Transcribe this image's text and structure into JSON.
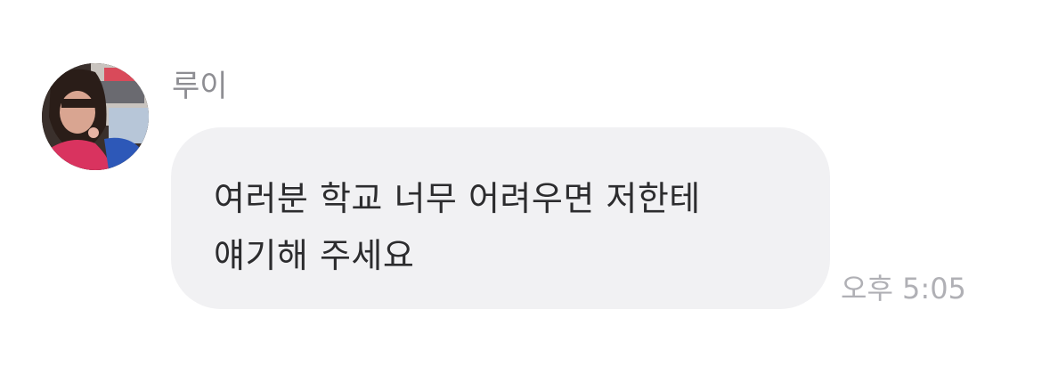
{
  "sender": {
    "name": "루이",
    "avatar_icon": "profile-photo"
  },
  "message": {
    "lines": [
      "여러분 학교 너무 어려우면 저한테",
      "얘기해 주세요"
    ]
  },
  "timestamp": "오후 5:05",
  "colors": {
    "bubble": "#f1f1f3",
    "name_text": "#8e8e93",
    "message_text": "#2c2c2e",
    "time_text": "#b0b0b5"
  }
}
